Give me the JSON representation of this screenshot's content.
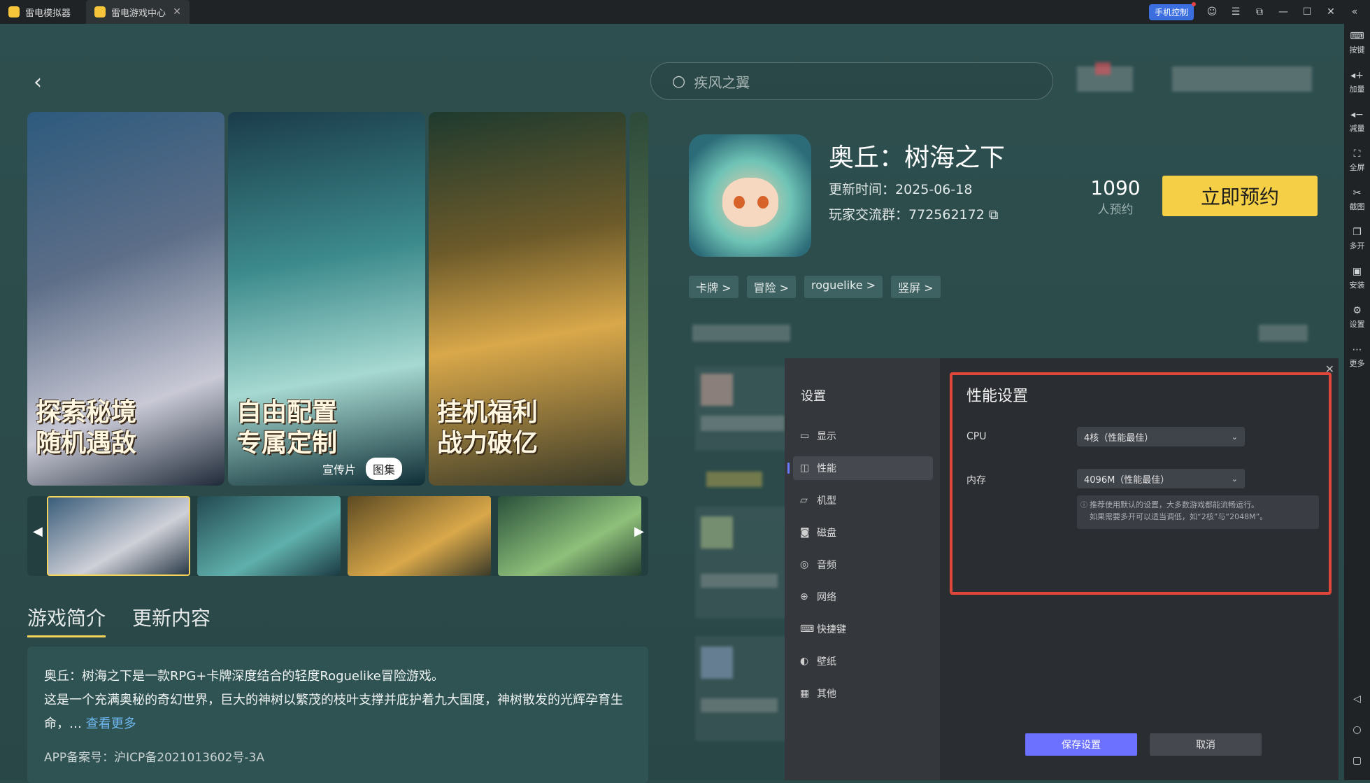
{
  "titlebar": {
    "tabs": [
      {
        "label": "雷电模拟器"
      },
      {
        "label": "雷电游戏中心"
      }
    ],
    "close_glyph": "✕",
    "phone_control": "手机控制",
    "icons": [
      "user-icon",
      "menu-icon",
      "restore-icon",
      "minimize-icon",
      "maximize-icon",
      "close-icon",
      "collapse-icon"
    ]
  },
  "right_sidebar": {
    "items": [
      {
        "label": "按键",
        "icon": "keyboard-icon"
      },
      {
        "label": "加量",
        "icon": "volume-up-icon"
      },
      {
        "label": "减量",
        "icon": "volume-down-icon"
      },
      {
        "label": "全屏",
        "icon": "fullscreen-icon"
      },
      {
        "label": "截图",
        "icon": "scissors-icon"
      },
      {
        "label": "多开",
        "icon": "multi-instance-icon"
      },
      {
        "label": "安装",
        "icon": "install-icon"
      },
      {
        "label": "设置",
        "icon": "gear-icon"
      },
      {
        "label": "更多",
        "icon": "more-icon"
      }
    ]
  },
  "search": {
    "placeholder": "疾风之翼"
  },
  "gallery": {
    "captions": [
      "探索秘境\n随机遇敌",
      "自由配置\n专属定制",
      "挂机福利\n战力破亿"
    ],
    "toggle": {
      "video": "宣传片",
      "gallery": "图集"
    }
  },
  "game": {
    "title": "奥丘：树海之下",
    "update_time": "更新时间：2025-06-18",
    "player_group": "玩家交流群：772562172",
    "reserve_count": "1090",
    "reserve_label": "人预约",
    "reserve_button": "立即预约",
    "tags": [
      "卡牌 >",
      "冒险 >",
      "roguelike >",
      "竖屏 >"
    ]
  },
  "intro": {
    "tabs": [
      "游戏简介",
      "更新内容"
    ],
    "line1": "奥丘：树海之下是一款RPG+卡牌深度结合的轻度Roguelike冒险游戏。",
    "line2": "这是一个充满奥秘的奇幻世界，巨大的神树以繁茂的枝叶支撑并庇护着九大国度，神树散发的光辉孕育生命，…",
    "more": "查看更多",
    "icp": "APP备案号：沪ICP备2021013602号-3A"
  },
  "settings_dialog": {
    "title": "设置",
    "nav": [
      {
        "label": "显示",
        "icon": "monitor-icon"
      },
      {
        "label": "性能",
        "icon": "performance-icon"
      },
      {
        "label": "机型",
        "icon": "folder-icon"
      },
      {
        "label": "磁盘",
        "icon": "disk-icon"
      },
      {
        "label": "音频",
        "icon": "gamepad-icon"
      },
      {
        "label": "网络",
        "icon": "globe-icon"
      },
      {
        "label": "快捷键",
        "icon": "keyboard-icon"
      },
      {
        "label": "壁纸",
        "icon": "palette-icon"
      },
      {
        "label": "其他",
        "icon": "grid-icon"
      }
    ],
    "active_nav": "性能",
    "perf_title": "性能设置",
    "cpu_label": "CPU",
    "cpu_value": "4核（性能最佳）",
    "mem_label": "内存",
    "mem_value": "4096M（性能最佳）",
    "hint_line1": "推荐使用默认的设置，大多数游戏都能流畅运行。",
    "hint_line2": "如果需要多开可以适当调低，如“2核”与“2048M”。",
    "save": "保存设置",
    "cancel": "取消",
    "highlight_color": "#e0473a",
    "accent_color": "#6c72ff"
  }
}
